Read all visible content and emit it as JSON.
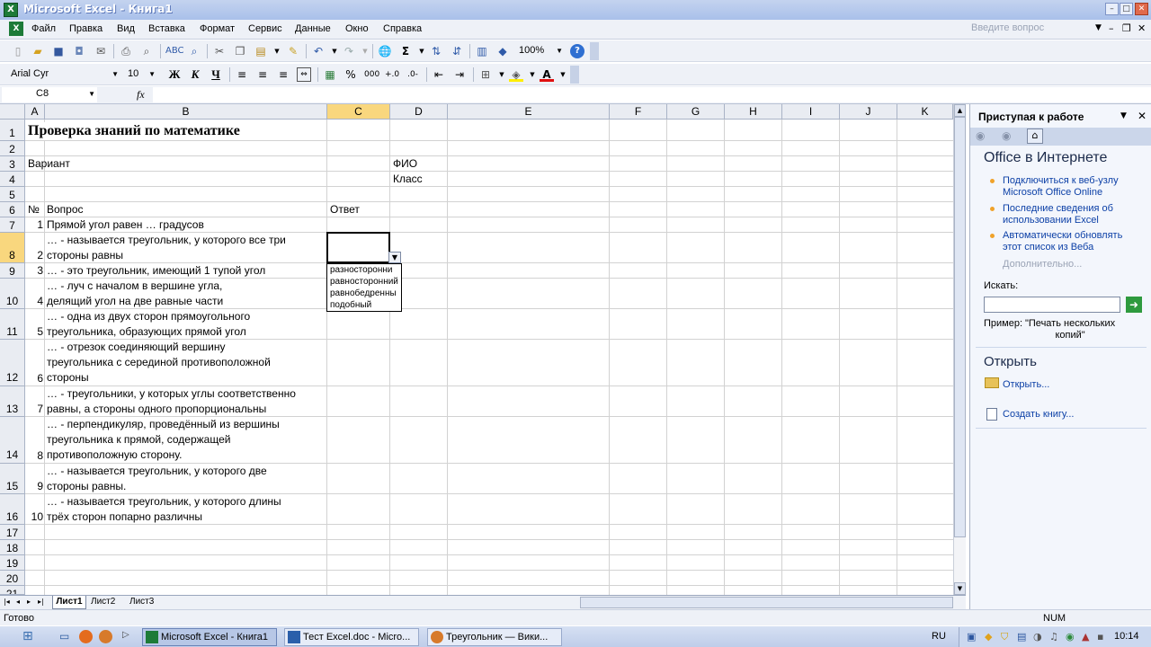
{
  "window": {
    "title": "Microsoft Excel - Книга1"
  },
  "menu": [
    "Файл",
    "Правка",
    "Вид",
    "Вставка",
    "Формат",
    "Сервис",
    "Данные",
    "Окно",
    "Справка"
  ],
  "ask_placeholder": "Введите вопрос",
  "toolbar": {
    "zoom": "100%",
    "font_name": "Arial Cyr",
    "font_size": "10",
    "bold": "Ж",
    "italic": "К",
    "underline": "Ч",
    "percent": "%",
    "thousands": "000"
  },
  "formula": {
    "name_box": "C8",
    "fx": "fx",
    "value": ""
  },
  "columns": [
    "A",
    "B",
    "C",
    "D",
    "E",
    "F",
    "G",
    "H",
    "I",
    "J",
    "K"
  ],
  "rows": [
    "1",
    "2",
    "3",
    "4",
    "5",
    "6",
    "7",
    "8",
    "9",
    "10",
    "11",
    "12",
    "13",
    "14",
    "15",
    "16",
    "17",
    "18",
    "19",
    "20",
    "21"
  ],
  "sheet": {
    "title": "Проверка знаний по математике",
    "variant": "Вариант",
    "fio": "ФИО",
    "klass": "Класс",
    "num_header": "№",
    "question_header": "Вопрос",
    "answer_header": "Ответ",
    "questions": [
      {
        "n": "1",
        "text": "Прямой угол равен … градусов"
      },
      {
        "n": "2",
        "text": "… - называется треугольник, у которого все три\nстороны равны"
      },
      {
        "n": "3",
        "text": "… - это треугольник, имеющий 1 тупой угол"
      },
      {
        "n": "4",
        "text": "… - луч с началом в вершине угла,\nделящий угол на две равные части"
      },
      {
        "n": "5",
        "text": "… - одна из двух сторон прямоугольного\nтреугольника, образующих прямой угол"
      },
      {
        "n": "6",
        "text": "… - отрезок соединяющий вершину\nтреугольника с серединой противоположной\nстороны"
      },
      {
        "n": "7",
        "text": "… - треугольники, у которых углы соответственно\nравны, а стороны одного пропорциональны"
      },
      {
        "n": "8",
        "text": "… - перпендикуляр, проведённый из вершины\nтреугольника к прямой, содержащей\nпротивоположную сторону."
      },
      {
        "n": "9",
        "text": "… - называется треугольник, у которого две\nстороны равны."
      },
      {
        "n": "10",
        "text": "… - называется треугольник, у которого длины\nтрёх сторон попарно различны"
      }
    ],
    "dropdown": [
      "разносторонни",
      "равносторонний",
      "равнобедренны",
      "подобный"
    ]
  },
  "tabs": [
    "Лист1",
    "Лист2",
    "Лист3"
  ],
  "status": {
    "ready": "Готово",
    "num": "NUM"
  },
  "taskpane": {
    "title": "Приступая к работе",
    "office_title": "Office в Интернете",
    "links": [
      "Подключиться к веб-узлу\nMicrosoft Office Online",
      "Последние сведения об\nиспользовании Excel",
      "Автоматически обновлять\nэтот список из Веба"
    ],
    "more": "Дополнительно...",
    "search_label": "Искать:",
    "example_label": "Пример:",
    "example_text": "\"Печать нескольких\nкопий\"",
    "open_title": "Открыть",
    "open_link": "Открыть...",
    "new_link": "Создать книгу..."
  },
  "taskbar": {
    "tasks": [
      "Microsoft Excel - Книга1",
      "Тест Excel.doc - Micro...",
      "Треугольник — Вики..."
    ],
    "lang": "RU",
    "time": "10:14"
  }
}
